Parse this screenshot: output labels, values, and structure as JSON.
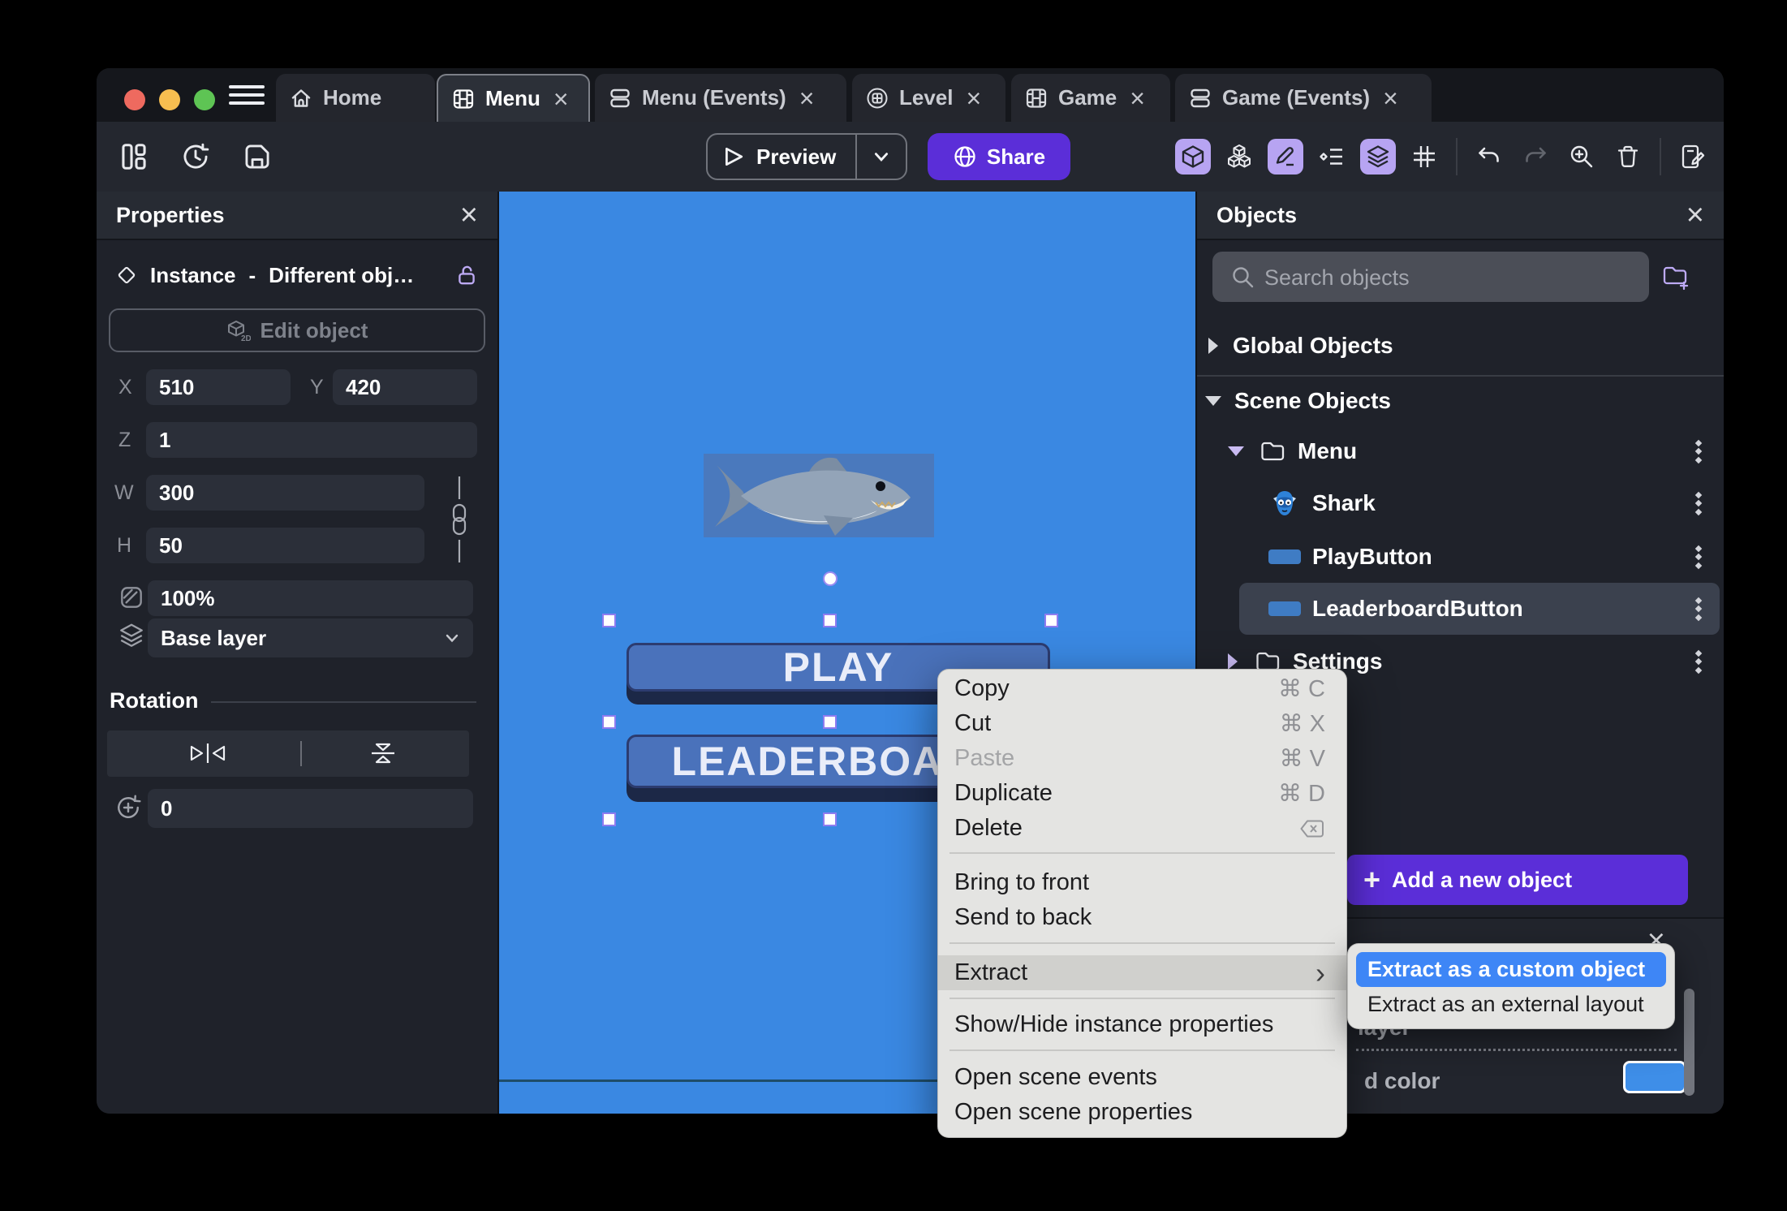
{
  "titlebar": {
    "tabs": [
      {
        "label": "Home"
      },
      {
        "label": "Menu"
      },
      {
        "label": "Menu (Events)"
      },
      {
        "label": "Level"
      },
      {
        "label": "Game"
      },
      {
        "label": "Game (Events)"
      }
    ]
  },
  "toolbar": {
    "preview_label": "Preview",
    "share_label": "Share"
  },
  "properties_panel": {
    "title": "Properties",
    "instance_label": "Instance",
    "separator": "-",
    "instance_value": "Different obj…",
    "edit_object_label": "Edit object",
    "fields": {
      "x_label": "X",
      "x_value": "510",
      "y_label": "Y",
      "y_value": "420",
      "z_label": "Z",
      "z_value": "1",
      "w_label": "W",
      "w_value": "300",
      "h_label": "H",
      "h_value": "50",
      "opacity_value": "100%",
      "layer_value": "Base layer"
    },
    "rotation_title": "Rotation",
    "rotation_value": "0"
  },
  "canvas": {
    "play_button_label": "PLAY",
    "leaderboard_button_label": "LEADERBOARD"
  },
  "objects_panel": {
    "title": "Objects",
    "search_placeholder": "Search objects",
    "global_objects_label": "Global Objects",
    "scene_objects_label": "Scene Objects",
    "tree": [
      {
        "label": "Menu"
      },
      {
        "label": "Shark"
      },
      {
        "label": "PlayButton"
      },
      {
        "label": "LeaderboardButton"
      },
      {
        "label": "Settings"
      }
    ],
    "add_object_label": "Add a new object"
  },
  "instance_properties_panel": {
    "layer_fragment": "layer",
    "color_fragment": "d color"
  },
  "context_menu": {
    "items": [
      {
        "label": "Copy",
        "shortcut": "⌘ C"
      },
      {
        "label": "Cut",
        "shortcut": "⌘ X"
      },
      {
        "label": "Paste",
        "shortcut": "⌘ V"
      },
      {
        "label": "Duplicate",
        "shortcut": "⌘ D"
      },
      {
        "label": "Delete"
      },
      {
        "label": "Bring to front"
      },
      {
        "label": "Send to back"
      },
      {
        "label": "Extract"
      },
      {
        "label": "Show/Hide instance properties"
      },
      {
        "label": "Open scene events"
      },
      {
        "label": "Open scene properties"
      }
    ]
  },
  "extract_submenu": {
    "items": [
      {
        "label": "Extract as a custom object"
      },
      {
        "label": "Extract as an external layout"
      }
    ]
  },
  "colors": {
    "accent_purple": "#5b2ed8",
    "accent_lavender": "#b7a4f2",
    "canvas_blue": "#3a88e2",
    "game_button_blue": "#4a72bb",
    "submenu_highlight_blue": "#3e86f6"
  }
}
